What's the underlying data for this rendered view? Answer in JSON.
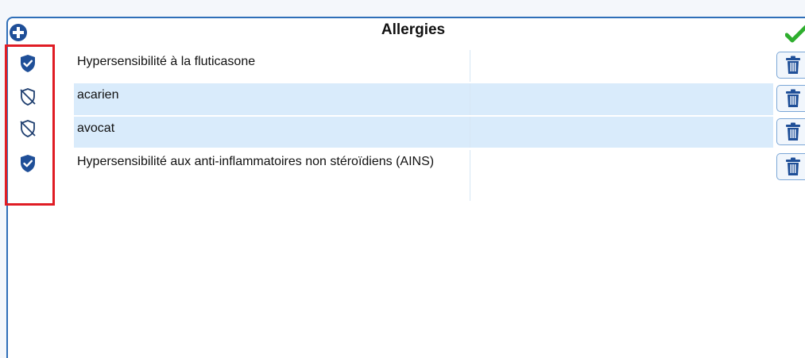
{
  "panel": {
    "title": "Allergies",
    "accent_color": "#2f6fb8",
    "selection_highlight_color": "#e01c24",
    "add_icon": "plus-circle-icon",
    "confirm_icon": "check-icon"
  },
  "allergies": [
    {
      "label": "Hypersensibilité à la fluticasone",
      "shield_icon": "shield-check-icon",
      "active": true
    },
    {
      "label": "acarien",
      "shield_icon": "shield-off-icon",
      "active": false
    },
    {
      "label": "avocat",
      "shield_icon": "shield-off-icon",
      "active": false
    },
    {
      "label": "Hypersensibilité aux anti-inflammatoires non stéroïdiens (AINS)",
      "shield_icon": "shield-check-icon",
      "active": true
    }
  ],
  "row_action_icon": "trash-icon"
}
